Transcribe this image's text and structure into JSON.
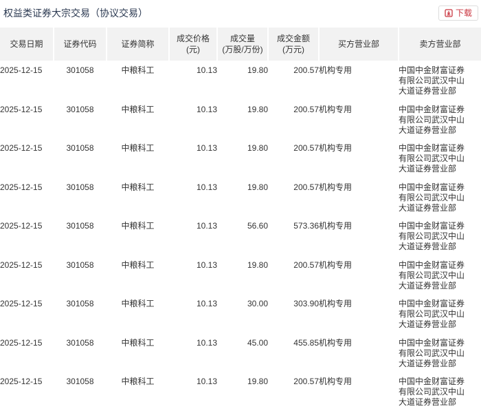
{
  "page": {
    "title": "权益类证券大宗交易（协议交易）",
    "download_label": "下载",
    "colors": {
      "accent_red": "#c9353f",
      "title_color": "#2c3a52",
      "header_bg": "#f2f2f2",
      "text": "#333333",
      "button_border": "#dddddd"
    }
  },
  "table": {
    "columns": [
      {
        "label": "交易日期"
      },
      {
        "label": "证券代码"
      },
      {
        "label": "证券简称"
      },
      {
        "label": "成交价格",
        "sub": "(元)"
      },
      {
        "label": "成交量",
        "sub": "(万股/万份)"
      },
      {
        "label": "成交金额",
        "sub": "(万元)"
      },
      {
        "label": "买方营业部"
      },
      {
        "label": "卖方营业部"
      }
    ],
    "rows": [
      {
        "date": "2025-12-15",
        "code": "301058",
        "name": "中粮科工",
        "price": "10.13",
        "volume": "19.80",
        "amount": "200.57",
        "buyer": "机构专用",
        "seller_lines": [
          "中国中金财富证券",
          "有限公司武汉中山",
          "大道证券营业部"
        ]
      },
      {
        "date": "2025-12-15",
        "code": "301058",
        "name": "中粮科工",
        "price": "10.13",
        "volume": "19.80",
        "amount": "200.57",
        "buyer": "机构专用",
        "seller_lines": [
          "中国中金财富证券",
          "有限公司武汉中山",
          "大道证券营业部"
        ]
      },
      {
        "date": "2025-12-15",
        "code": "301058",
        "name": "中粮科工",
        "price": "10.13",
        "volume": "19.80",
        "amount": "200.57",
        "buyer": "机构专用",
        "seller_lines": [
          "中国中金财富证券",
          "有限公司武汉中山",
          "大道证券营业部"
        ]
      },
      {
        "date": "2025-12-15",
        "code": "301058",
        "name": "中粮科工",
        "price": "10.13",
        "volume": "19.80",
        "amount": "200.57",
        "buyer": "机构专用",
        "seller_lines": [
          "中国中金财富证券",
          "有限公司武汉中山",
          "大道证券营业部"
        ]
      },
      {
        "date": "2025-12-15",
        "code": "301058",
        "name": "中粮科工",
        "price": "10.13",
        "volume": "56.60",
        "amount": "573.36",
        "buyer": "机构专用",
        "seller_lines": [
          "中国中金财富证券",
          "有限公司武汉中山",
          "大道证券营业部"
        ]
      },
      {
        "date": "2025-12-15",
        "code": "301058",
        "name": "中粮科工",
        "price": "10.13",
        "volume": "19.80",
        "amount": "200.57",
        "buyer": "机构专用",
        "seller_lines": [
          "中国中金财富证券",
          "有限公司武汉中山",
          "大道证券营业部"
        ]
      },
      {
        "date": "2025-12-15",
        "code": "301058",
        "name": "中粮科工",
        "price": "10.13",
        "volume": "30.00",
        "amount": "303.90",
        "buyer": "机构专用",
        "seller_lines": [
          "中国中金财富证券",
          "有限公司武汉中山",
          "大道证券营业部"
        ]
      },
      {
        "date": "2025-12-15",
        "code": "301058",
        "name": "中粮科工",
        "price": "10.13",
        "volume": "45.00",
        "amount": "455.85",
        "buyer": "机构专用",
        "seller_lines": [
          "中国中金财富证券",
          "有限公司武汉中山",
          "大道证券营业部"
        ]
      },
      {
        "date": "2025-12-15",
        "code": "301058",
        "name": "中粮科工",
        "price": "10.13",
        "volume": "19.80",
        "amount": "200.57",
        "buyer": "机构专用",
        "seller_lines": [
          "中国中金财富证券",
          "有限公司武汉中山",
          "大道证券营业部"
        ]
      }
    ]
  }
}
